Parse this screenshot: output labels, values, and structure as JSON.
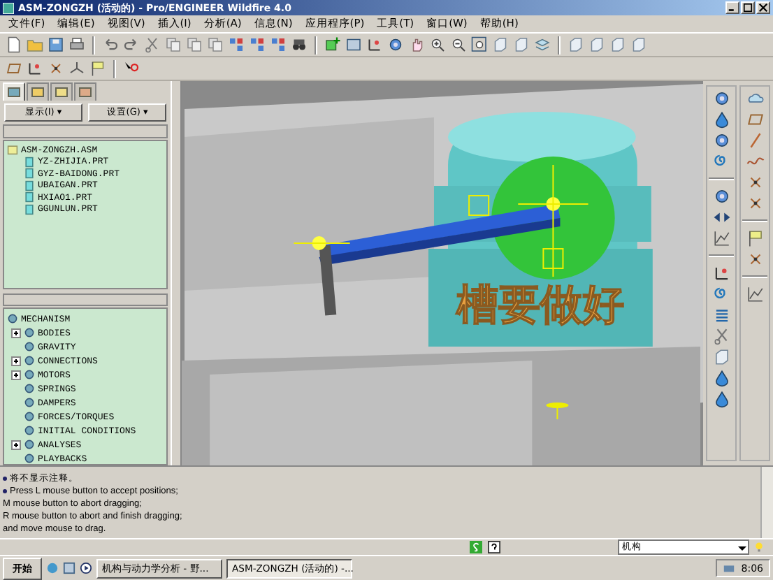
{
  "window": {
    "title": "ASM-ZONGZH (活动的) - Pro/ENGINEER Wildfire 4.0"
  },
  "menu": [
    "文件(F)",
    "编辑(E)",
    "视图(V)",
    "插入(I)",
    "分析(A)",
    "信息(N)",
    "应用程序(P)",
    "工具(T)",
    "窗口(W)",
    "帮助(H)"
  ],
  "navigator_tabs": [
    {
      "selected": true
    },
    {
      "selected": false
    },
    {
      "selected": false
    },
    {
      "selected": false
    }
  ],
  "navigator_buttons": [
    "显示(I) ▾",
    "设置(G) ▾"
  ],
  "model_tree": {
    "label": "ASM-ZONGZH.ASM",
    "children": [
      {
        "label": "YZ-ZHIJIA.PRT"
      },
      {
        "label": "GYZ-BAIDONG.PRT"
      },
      {
        "label": "UBAIGAN.PRT"
      },
      {
        "label": "HXIAO1.PRT"
      },
      {
        "label": "GGUNLUN.PRT"
      }
    ]
  },
  "mechanism_tree": {
    "label": "MECHANISM",
    "children": [
      {
        "label": "BODIES",
        "expanded": false
      },
      {
        "label": "GRAVITY"
      },
      {
        "label": "CONNECTIONS",
        "expanded": false
      },
      {
        "label": "MOTORS",
        "expanded": false
      },
      {
        "label": "SPRINGS"
      },
      {
        "label": "DAMPERS"
      },
      {
        "label": "FORCES/TORQUES"
      },
      {
        "label": "INITIAL CONDITIONS"
      },
      {
        "label": "ANALYSES",
        "expanded": false
      },
      {
        "label": "PLAYBACKS"
      }
    ]
  },
  "model": {
    "embossed_text": "槽要做好"
  },
  "messages": [
    {
      "text": "将不显示注释。",
      "bullet": true
    },
    {
      "text": "Press L mouse button to accept positions;",
      "bullet": true
    },
    {
      "text": "M mouse button to abort dragging;",
      "bullet": false
    },
    {
      "text": "R mouse button to abort and finish dragging;",
      "bullet": false
    },
    {
      "text": "and move mouse to drag.",
      "bullet": false
    }
  ],
  "status_bar": {
    "filter": "机构"
  },
  "taskbar": {
    "start": "开始",
    "tasks": [
      {
        "label": "机构与动力学分析 - 野...",
        "selected": false
      },
      {
        "label": "ASM-ZONGZH (活动的) -...",
        "selected": true
      }
    ],
    "clock": "8:06"
  }
}
